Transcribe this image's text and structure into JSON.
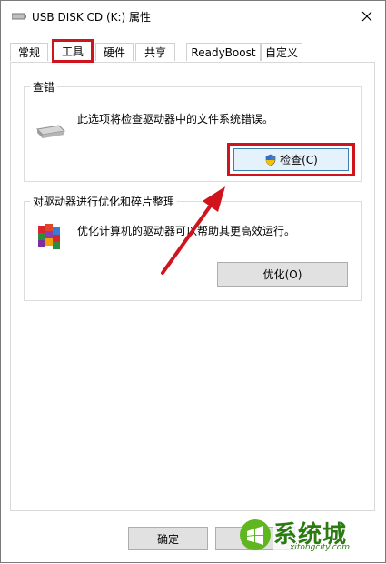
{
  "window": {
    "title": "USB DISK CD (K:) 属性"
  },
  "tabs": [
    {
      "label": "常规"
    },
    {
      "label": "工具"
    },
    {
      "label": "硬件"
    },
    {
      "label": "共享"
    },
    {
      "label": "ReadyBoost"
    },
    {
      "label": "自定义"
    }
  ],
  "check_group": {
    "title": "查错",
    "description": "此选项将检查驱动器中的文件系统错误。",
    "button_label": "检查(C)"
  },
  "optimize_group": {
    "title": "对驱动器进行优化和碎片整理",
    "description": "优化计算机的驱动器可以帮助其更高效运行。",
    "button_label": "优化(O)"
  },
  "footer": {
    "ok_label": "确定"
  },
  "watermark": {
    "brand": "系统城",
    "url": "xitongcity.com"
  },
  "colors": {
    "highlight": "#d0141e",
    "watermark_green": "#2b7a12"
  },
  "icons": {
    "drive": "usb-drive-icon",
    "defrag": "defrag-icon",
    "shield": "uac-shield-icon",
    "close": "close-icon"
  }
}
